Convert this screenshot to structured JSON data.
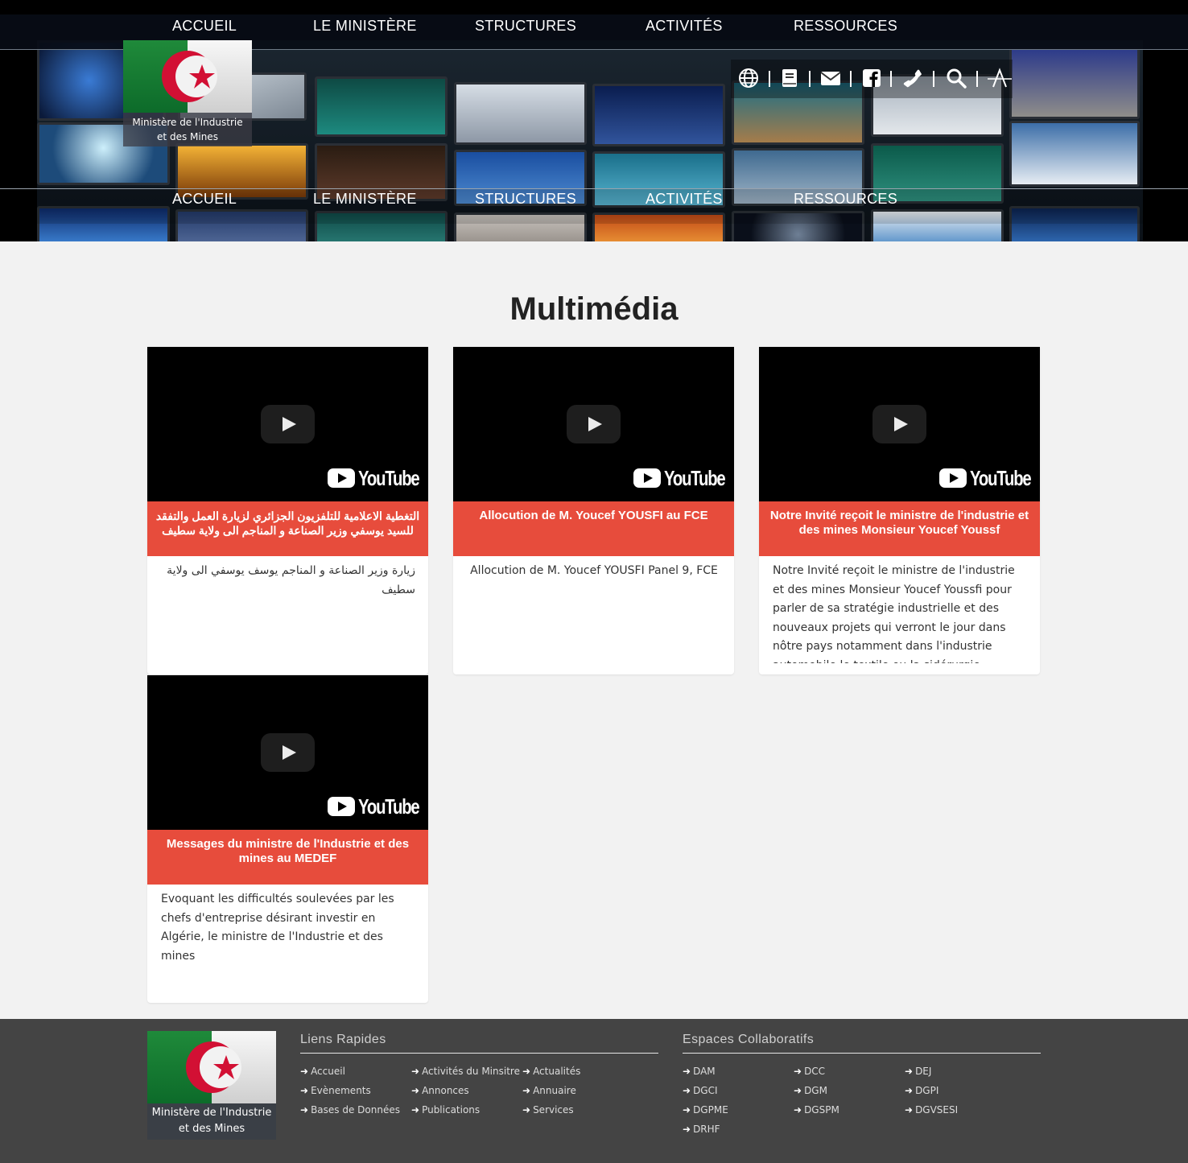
{
  "nav": {
    "items": [
      "ACCUEIL",
      "LE MINISTÈRE",
      "STRUCTURES",
      "ACTIVITÉS",
      "RESSOURCES"
    ]
  },
  "logo": {
    "caption_line1": "Ministère de l'Industrie",
    "caption_line2": "et des Mines"
  },
  "toolbar_icons": [
    "globe-icon",
    "book-icon",
    "envelope-icon",
    "facebook-icon",
    "phone-icon",
    "search-icon",
    "font-size-icon"
  ],
  "main": {
    "title": "Multimédia",
    "cards": [
      {
        "title": "التغطية الاعلامية للتلفزيون الجزائري لزيارة العمل والتفقد للسيد يوسفي وزير الصناعة و المناجم الى ولاية سطيف",
        "description": "زيارة وزير الصناعة و المناجم يوسف يوسفي الى ولاية سطيف",
        "youtube": "YouTube"
      },
      {
        "title": "Allocution de M. Youcef YOUSFI au FCE",
        "description": "Allocution de M. Youcef YOUSFI Panel 9, FCE",
        "youtube": "YouTube"
      },
      {
        "title": "Notre Invité reçoit le ministre de l'industrie et des mines Monsieur Youcef Youssf",
        "description": "Notre Invité reçoit le ministre de l'industrie et des mines Monsieur Youcef Youssfi pour parler de sa stratégie industrielle et des nouveaux projets qui verront le jour dans nôtre pays notamment dans l'industrie automobile le textile ou la sidérurgie",
        "youtube": "YouTube"
      },
      {
        "title": "Messages du ministre de l'Industrie et des mines au MEDEF",
        "description": "Evoquant les difficultés soulevées par les chefs d'entreprise désirant investir en Algérie, le ministre de l'Industrie et des mines",
        "youtube": "YouTube"
      }
    ]
  },
  "footer": {
    "logo_caption_line1": "Ministère de l'Industrie",
    "logo_caption_line2": "et des Mines",
    "quick_links": {
      "heading": "Liens Rapides",
      "links": [
        "Accueil",
        "Activités du Minsitre",
        "Actualités",
        "Evènements",
        "Annonces",
        "Annuaire",
        "Bases de Données",
        "Publications",
        "Services"
      ]
    },
    "collab": {
      "heading": "Espaces Collaboratifs",
      "links": [
        "DAM",
        "DCC",
        "DEJ",
        "DGCI",
        "DGM",
        "DGPI",
        "DGPME",
        "DGSPM",
        "DGVSESI",
        "DRHF"
      ]
    }
  },
  "colors": {
    "accent": "#e74c3c",
    "footer_bg": "#444444",
    "page_bg": "#f2f2f2"
  }
}
